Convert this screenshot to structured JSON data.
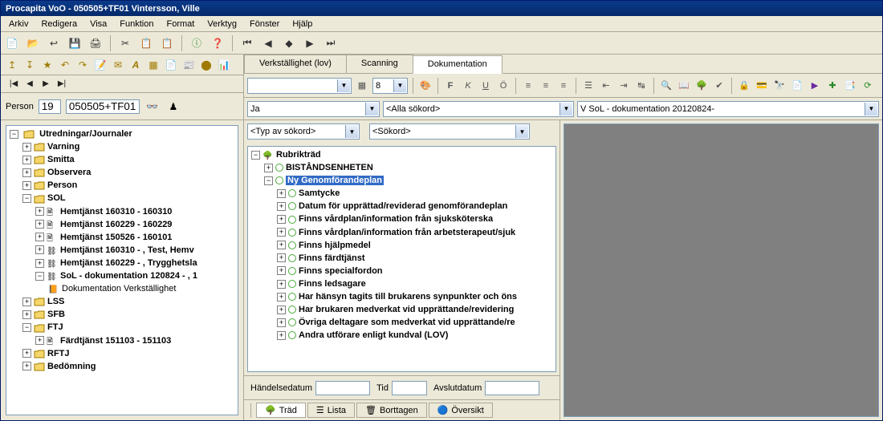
{
  "title": "Procapita VoO - 050505+TF01 Vintersson, Ville",
  "menu": [
    "Arkiv",
    "Redigera",
    "Visa",
    "Funktion",
    "Format",
    "Verktyg",
    "Fönster",
    "Hjälp"
  ],
  "person": {
    "label": "Person",
    "num": "19",
    "id": "050505+TF01"
  },
  "left_tree": {
    "root": "Utredningar/Journaler",
    "nodes": [
      {
        "label": "Varning",
        "icon": "folder"
      },
      {
        "label": "Smitta",
        "icon": "folder"
      },
      {
        "label": "Observera",
        "icon": "folder"
      },
      {
        "label": "Person",
        "icon": "folder"
      },
      {
        "label": "SOL",
        "icon": "folder-open",
        "children": [
          {
            "label": "Hemtjänst 160310 - 160310",
            "icon": "doc"
          },
          {
            "label": "Hemtjänst 160229 - 160229",
            "icon": "doc"
          },
          {
            "label": "Hemtjänst 150526 - 160101",
            "icon": "doc"
          },
          {
            "label": "Hemtjänst 160310 - , Test, Hemv",
            "icon": "link"
          },
          {
            "label": "Hemtjänst 160229 - , Trygghetsla",
            "icon": "link"
          },
          {
            "label": "SoL - dokumentation 120824 - , 1",
            "icon": "link",
            "bold": true,
            "expanded": true,
            "children": [
              {
                "label": "Dokumentation Verkställighet",
                "icon": "book"
              }
            ]
          }
        ]
      },
      {
        "label": "LSS",
        "icon": "folder"
      },
      {
        "label": "SFB",
        "icon": "folder"
      },
      {
        "label": "FTJ",
        "icon": "folder-open",
        "children": [
          {
            "label": "Färdtjänst 151103 - 151103",
            "icon": "doc"
          }
        ]
      },
      {
        "label": "RFTJ",
        "icon": "folder"
      },
      {
        "label": "Bedömning",
        "icon": "folder"
      }
    ]
  },
  "tabs": {
    "items": [
      "Verkställighet (lov)",
      "Scanning",
      "Dokumentation"
    ],
    "active": 2
  },
  "format_bar": {
    "font_size": "8",
    "btns": [
      "F",
      "K",
      "U",
      "Ö"
    ]
  },
  "row2": {
    "field1": "Ja",
    "field2": "<Alla sökord>",
    "field3": "V SoL - dokumentation 20120824-"
  },
  "row3": {
    "type_label": "<Typ av sökord>",
    "sokord": "<Sökord>"
  },
  "rubriktrad": {
    "root": "Rubrikträd",
    "section": "BISTÅNDSENHETEN",
    "selected": "Ny Genomförandeplan",
    "items": [
      "Samtycke",
      "Datum för upprättad/reviderad genomförandeplan",
      "Finns vårdplan/information från sjuksköterska",
      "Finns vårdplan/information från arbetsterapeut/sjuk",
      "Finns hjälpmedel",
      "Finns färdtjänst",
      "Finns specialfordon",
      "Finns ledsagare",
      "Har hänsyn tagits till brukarens synpunkter och öns",
      "Har brukaren medverkat vid upprättande/revidering",
      "Övriga deltagare som medverkat vid upprättande/re",
      "Andra utförare enligt kundval (LOV)"
    ]
  },
  "bottom_fields": {
    "f1": "Händelsedatum",
    "f2": "Tid",
    "f3": "Avslutdatum"
  },
  "bottom_tabs": [
    "Träd",
    "Lista",
    "Borttagen",
    "Översikt"
  ]
}
